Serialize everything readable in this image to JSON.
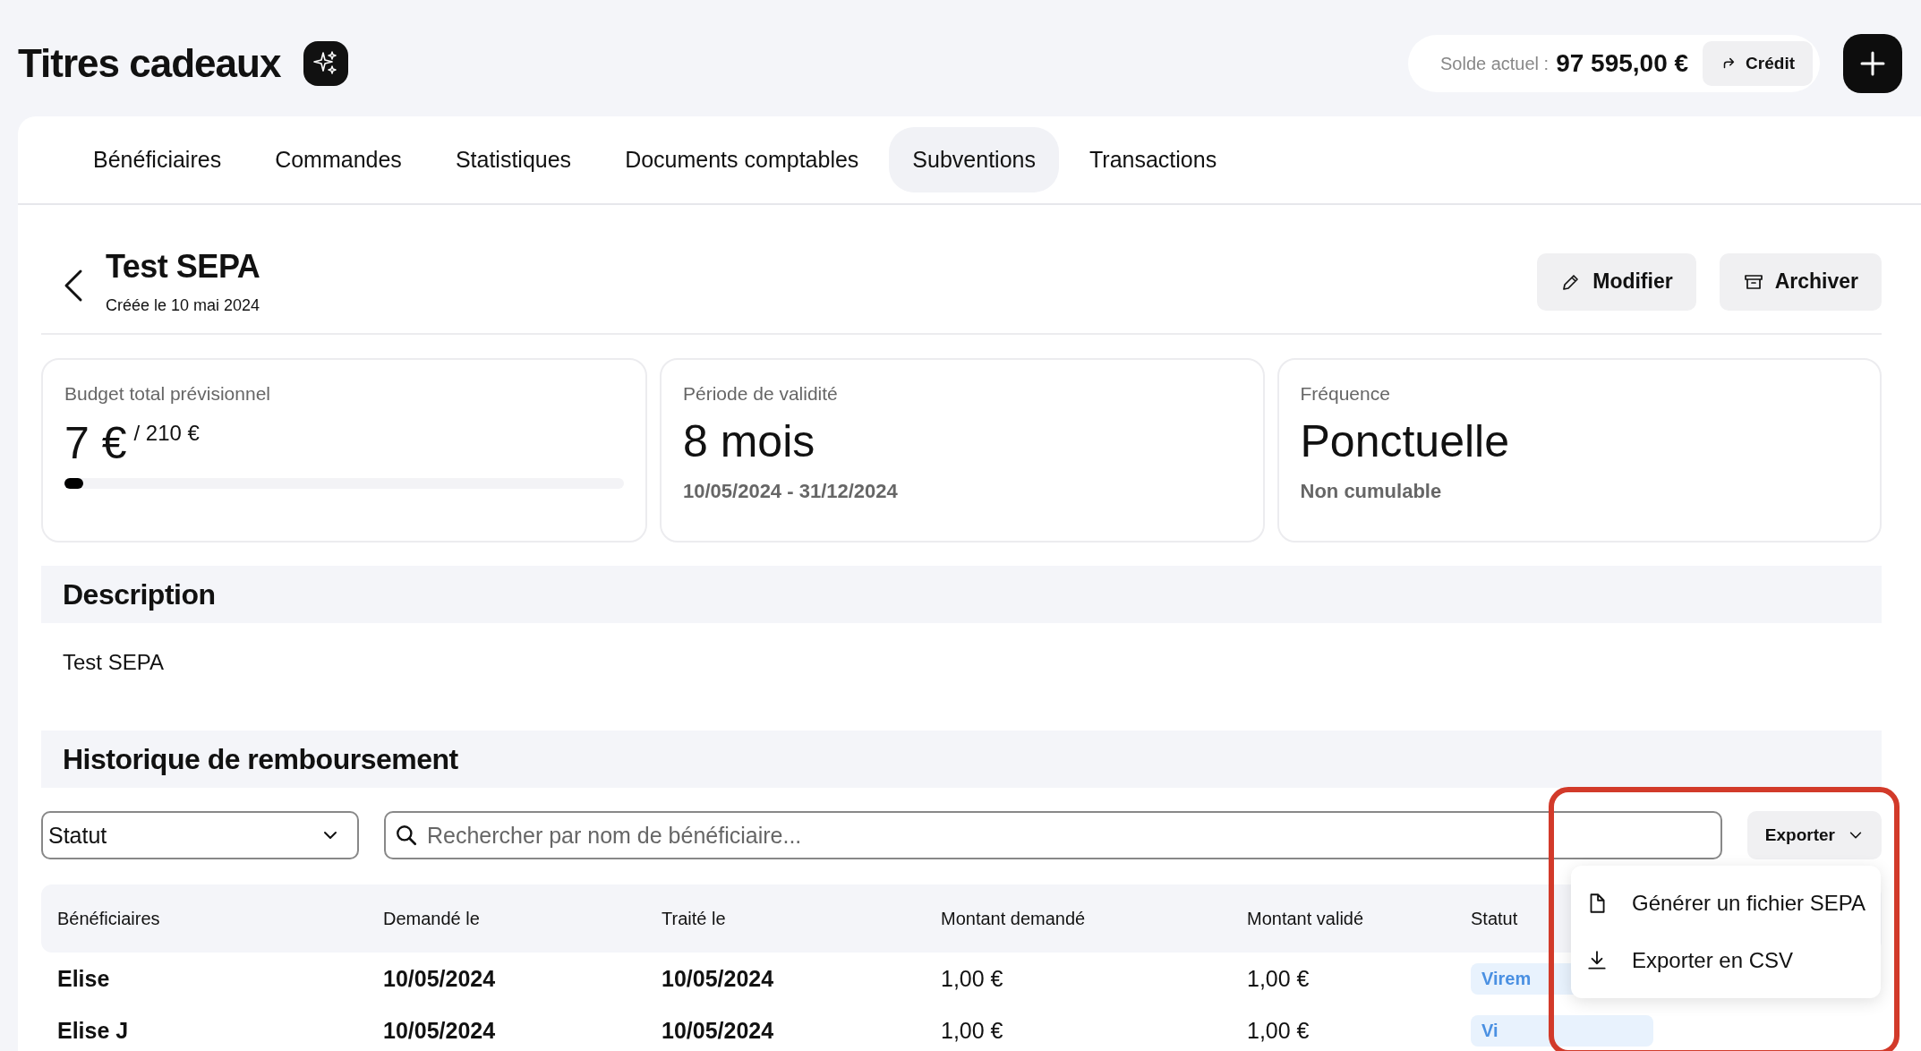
{
  "header": {
    "title": "Titres cadeaux",
    "balance_label": "Solde actuel :",
    "balance_value": "97 595,00 €",
    "credit_button": "Crédit"
  },
  "tabs": [
    {
      "label": "Bénéficiaires",
      "selected": false
    },
    {
      "label": "Commandes",
      "selected": false
    },
    {
      "label": "Statistiques",
      "selected": false
    },
    {
      "label": "Documents comptables",
      "selected": false
    },
    {
      "label": "Subventions",
      "selected": true
    },
    {
      "label": "Transactions",
      "selected": false
    }
  ],
  "subsidy": {
    "title": "Test SEPA",
    "created": "Créée le 10 mai 2024",
    "buttons": [
      {
        "kind": "edit",
        "label": "Modifier"
      },
      {
        "kind": "archive",
        "label": "Archiver"
      }
    ]
  },
  "cards": [
    {
      "kind": "budget",
      "label": "Budget total prévisionnel",
      "value": "7 €",
      "total": "/ 210 €",
      "level": 0.033
    },
    {
      "kind": "period",
      "label": "Période de validité",
      "value": "8 mois",
      "detail": "10/05/2024 - 31/12/2024"
    },
    {
      "kind": "frequency",
      "label": "Fréquence",
      "value": "Ponctuelle",
      "detail": "Non cumulable"
    }
  ],
  "description": {
    "heading": "Description",
    "text": "Test SEPA"
  },
  "history": {
    "heading": "Historique de remboursement",
    "status_filter": "Statut",
    "search": {
      "placeholder": "Rechercher par nom de bénéficiaire..."
    },
    "export_button": "Exporter",
    "export_menu": [
      {
        "kind": "file",
        "label": "Générer un fichier SEPA"
      },
      {
        "kind": "download",
        "label": "Exporter en CSV"
      }
    ],
    "table": {
      "columns": [
        "Bénéficiaires",
        "Demandé le",
        "Traité le",
        "Montant demandé",
        "Montant validé",
        "Statut"
      ],
      "rows": [
        {
          "beneficiary": "Elise",
          "requested": "10/05/2024",
          "processed": "10/05/2024",
          "amount_requested": "1,00 €",
          "amount_validated": "1,00 €",
          "status": "Virem"
        },
        {
          "beneficiary": "Elise J",
          "requested": "10/05/2024",
          "processed": "10/05/2024",
          "amount_requested": "1,00 €",
          "amount_validated": "1,00 €",
          "status": "Vi"
        }
      ]
    }
  }
}
